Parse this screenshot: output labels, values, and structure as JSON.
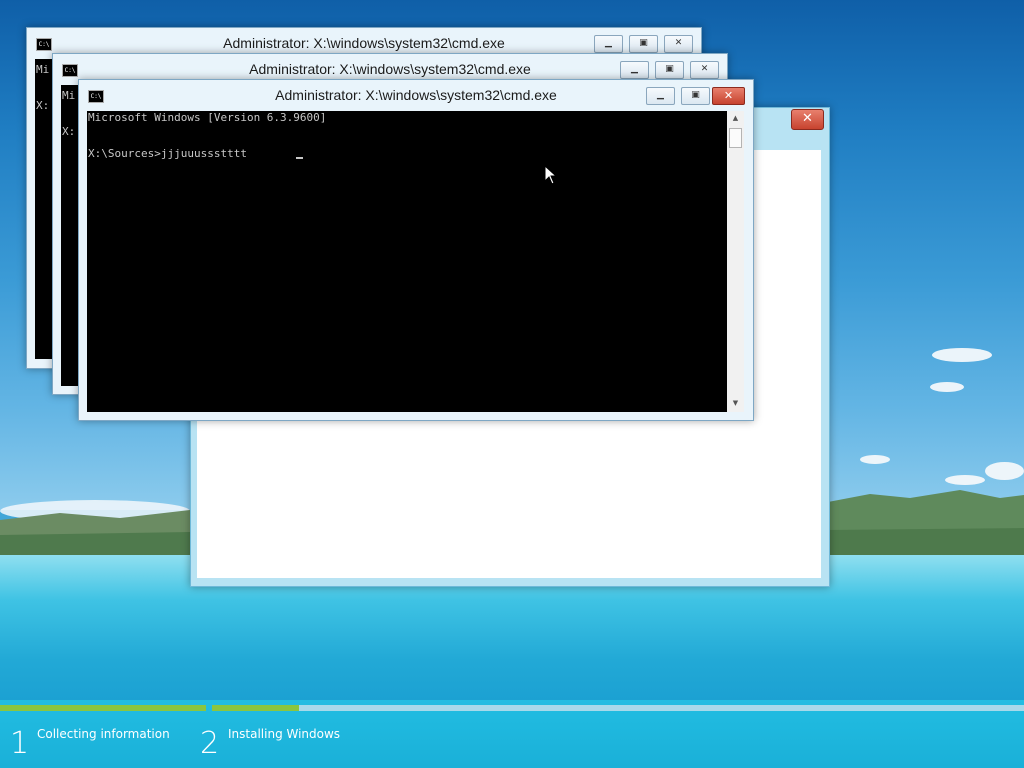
{
  "cmd_windows": [
    {
      "title": "Administrator: X:\\windows\\system32\\cmd.exe",
      "partial_lines": [
        "Mi",
        "X:"
      ]
    },
    {
      "title": "Administrator: X:\\windows\\system32\\cmd.exe",
      "partial_lines": [
        "Mi",
        "X:"
      ]
    },
    {
      "title": "Administrator: X:\\windows\\system32\\cmd.exe",
      "console_lines": [
        "Microsoft Windows [Version 6.3.9600]",
        "",
        "X:\\Sources>jjjuuussstttt"
      ]
    }
  ],
  "icons": {
    "cmd_app": "cmd-icon",
    "minimize": "minimize-icon",
    "maximize": "maximize-icon",
    "close": "close-icon"
  },
  "setup_window": {
    "close_glyph": "✕"
  },
  "setup_steps": [
    {
      "number": "1",
      "label": "Collecting information",
      "progress": 1.0
    },
    {
      "number": "2",
      "label": "Installing Windows",
      "progress": 0.1
    }
  ],
  "colors": {
    "progress": "#8bc53f",
    "console_bg": "#000000",
    "console_fg": "#c7c7c7"
  }
}
